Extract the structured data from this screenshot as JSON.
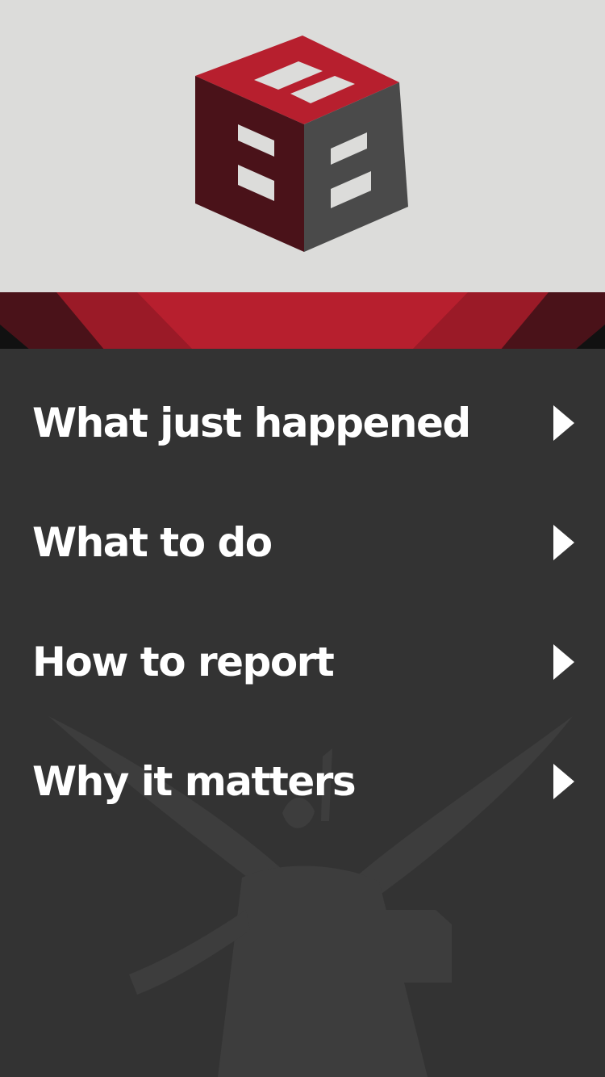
{
  "app": {
    "logo": "BBB-cube-logo",
    "colors": {
      "header_bg": "#dcdcda",
      "content_bg": "#333333",
      "brand_red": "#b71f2e",
      "brand_dark_red": "#4a1219",
      "brand_gray": "#4a4a4a",
      "text": "#ffffff"
    }
  },
  "menu": {
    "items": [
      {
        "label": "What just happened",
        "icon": "chevron-right-icon"
      },
      {
        "label": "What to do",
        "icon": "chevron-right-icon"
      },
      {
        "label": "How to report",
        "icon": "chevron-right-icon"
      },
      {
        "label": "Why it matters",
        "icon": "chevron-right-icon"
      }
    ]
  },
  "background": {
    "watermark": "torch-angel-icon"
  }
}
